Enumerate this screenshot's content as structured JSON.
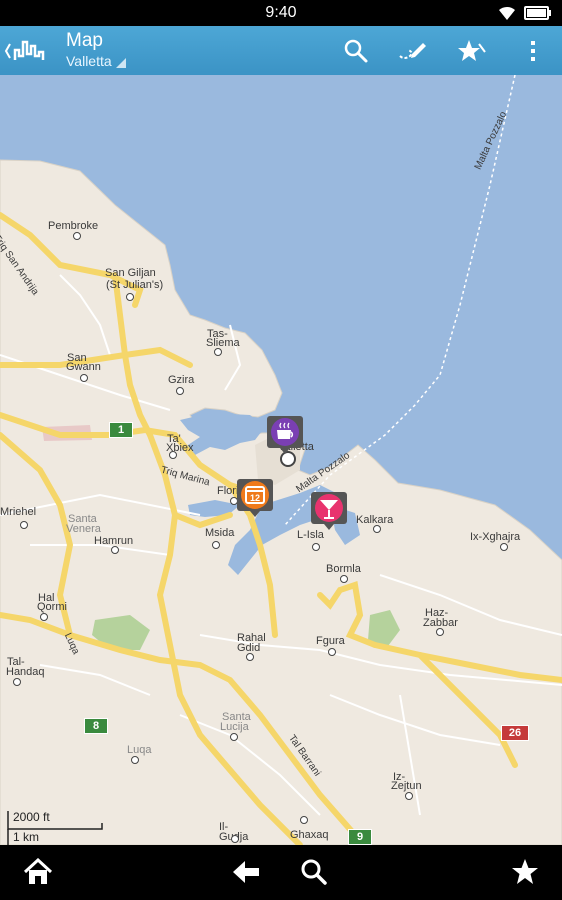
{
  "status_bar": {
    "time": "9:40",
    "icons": [
      "wifi-icon",
      "battery-icon"
    ]
  },
  "action_bar": {
    "title": "Map",
    "subtitle": "Valletta",
    "actions": [
      "search-icon",
      "draw-route-icon",
      "favorites-star-icon",
      "overflow-menu-icon"
    ]
  },
  "map": {
    "labels": {
      "pembroke": "Pembroke",
      "triq_san_andrija": "Triq San Andrija",
      "san_giljan": "San Giljan",
      "st_julians": "(St Julian's)",
      "tas": "Tas-",
      "sliema": "Sliema",
      "san": "San",
      "gwann": "Gwann",
      "gzira": "Gzira",
      "ta": "Ta'",
      "xbiex": "Xbiex",
      "valletta": "Valletta",
      "triq_marina": "Triq Marina",
      "floriana": "Floriana",
      "santa": "Santa",
      "venera": "Venera",
      "msida": "Msida",
      "mriehel": "Mriehel",
      "hamrun": "Hamrun",
      "malta_pozzalo_1": "Malta Pozzalo",
      "malta_pozzalo_2": "Malta Pozzalo",
      "kalkara": "Kalkara",
      "l_isla": "L-Isla",
      "ix_xghajra": "Ix-Xghajra",
      "bormla": "Bormla",
      "hal": "Hal",
      "qormi": "Qormi",
      "haz": "Haz-",
      "zabbar": "Zabbar",
      "rahal": "Rahal",
      "gdid": "Gdid",
      "fgura": "Fgura",
      "tal": "Tal-",
      "handaq": "Handaq",
      "luqa_road": "Luqa",
      "santa2": "Santa",
      "lucija": "Lucija",
      "tal_barrani": "Tal Barrani",
      "luqa": "Luqa",
      "iz": "Iz-",
      "zejtun": "Zejtun",
      "il": "Il-",
      "gudja": "Gudja",
      "ghaxaq": "Ghaxaq"
    },
    "road_shields": [
      "1",
      "8",
      "26",
      "9"
    ],
    "pois": [
      "cafe-poi-icon",
      "calendar-event-poi-icon",
      "cocktail-bar-poi-icon"
    ],
    "scale": {
      "feet": "2000 ft",
      "km": "1 km"
    }
  },
  "nav_bar": {
    "buttons": [
      "home-icon",
      "back-arrow-icon",
      "search-icon",
      "star-icon"
    ]
  },
  "colors": {
    "action_bar": "#4da7d6",
    "land": "#efe9e0",
    "sea": "#9ab9de",
    "highway": "#f5d66a",
    "park": "#b5d29c",
    "cafe_poi": "#7a3fb3",
    "event_poi": "#ef7a1a",
    "bar_poi": "#e8336e"
  }
}
